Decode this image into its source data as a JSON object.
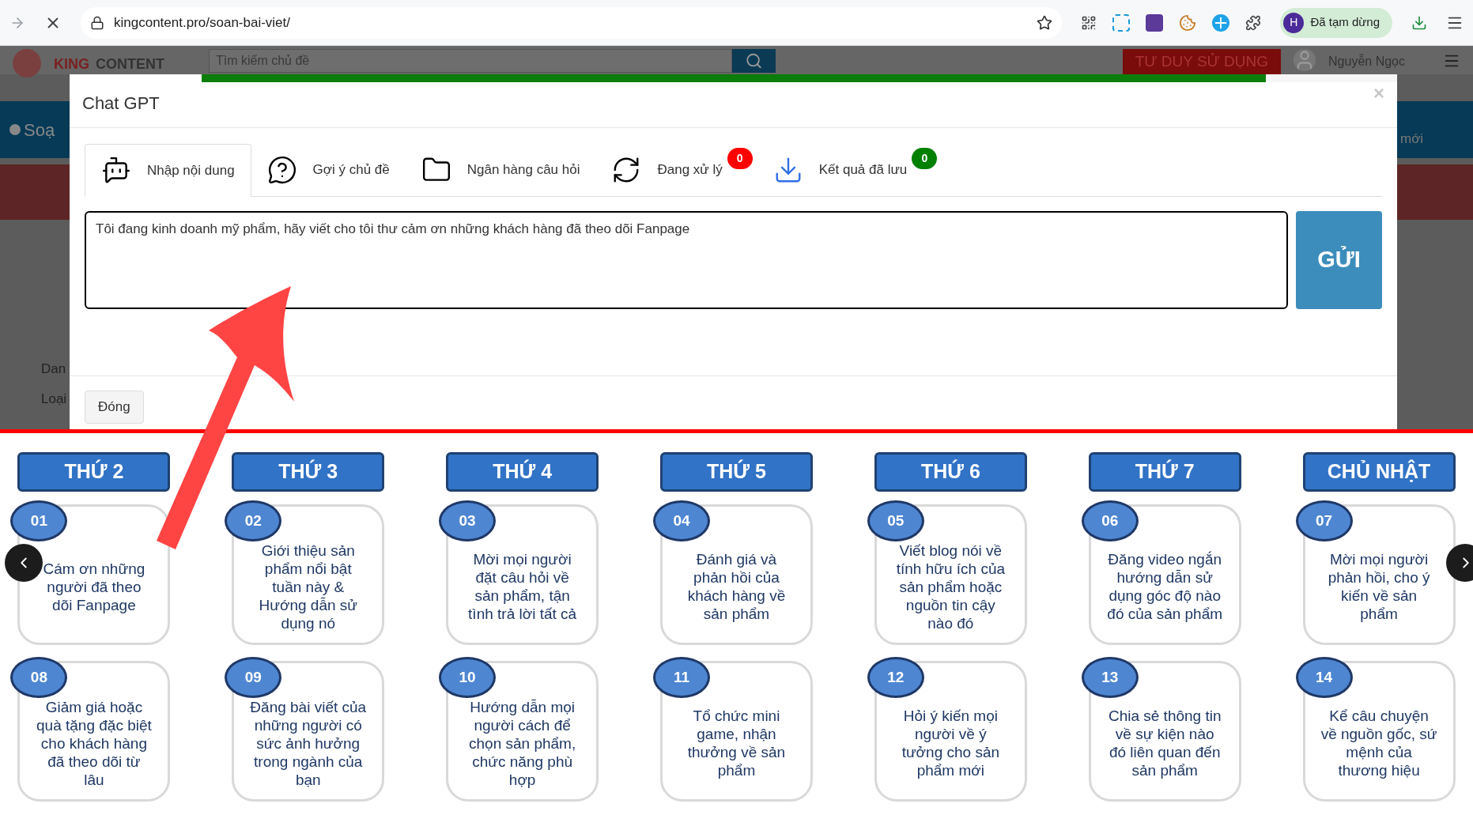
{
  "browser": {
    "url": "kingcontent.pro/soan-bai-viet/",
    "profile": {
      "initial": "H",
      "status": "Đã tạm dừng"
    }
  },
  "background_page": {
    "logo": [
      "KING",
      "CONTENT"
    ],
    "search_placeholder": "Tìm kiếm chủ đề",
    "header_button": "TƯ DUY SỬ DỤNG",
    "user_name": "Nguyễn Ngọc",
    "nav_left": "Soạ",
    "nav_right": "mới",
    "labels": [
      "Dan",
      "Loại"
    ]
  },
  "modal": {
    "title": "Chat GPT",
    "close": "×",
    "progress": {
      "level": 0.89
    },
    "tabs": [
      {
        "label": "Nhập nội dung",
        "selected": true
      },
      {
        "label": "Gợi ý chủ đề",
        "selected": false
      },
      {
        "label": "Ngân hàng câu hỏi",
        "selected": false
      },
      {
        "label": "Đang xử lý",
        "selected": false,
        "badge": {
          "text": "0",
          "color": "#ff0000"
        }
      },
      {
        "label": "Kết quả đã lưu",
        "selected": false,
        "badge": {
          "text": "0",
          "color": "#008000"
        }
      }
    ],
    "message": "Tôi đang kinh doanh mỹ phẩm, hãy viết cho tôi thư cảm ơn những khách hàng đã theo dõi Fanpage",
    "send_button": "GỬI",
    "close_button": "Đóng"
  },
  "calendar": {
    "days": [
      {
        "name": "THỨ 2",
        "tasks": [
          {
            "number": "01",
            "text": "Cám ơn những người đã theo dõi Fanpage"
          },
          {
            "number": "08",
            "text": "Giảm giá hoặc quà tặng đặc biệt cho khách hàng đã theo dõi từ lâu"
          }
        ]
      },
      {
        "name": "THỨ 3",
        "tasks": [
          {
            "number": "02",
            "text": "Giới thiệu sản phẩm nổi bật tuần này & Hướng dẫn sử dụng nó"
          },
          {
            "number": "09",
            "text": "Đăng bài viết của những người có sức ảnh hưởng trong ngành của bạn"
          }
        ]
      },
      {
        "name": "THỨ 4",
        "tasks": [
          {
            "number": "03",
            "text": "Mời mọi người đặt câu hỏi về sản phẩm, tận tình trả lời tất cả"
          },
          {
            "number": "10",
            "text": "Hướng dẫn mọi người cách để chọn sản phẩm, chức năng phù hợp"
          }
        ]
      },
      {
        "name": "THỨ 5",
        "tasks": [
          {
            "number": "04",
            "text": "Đánh giá và phản hồi của khách hàng về sản phẩm"
          },
          {
            "number": "11",
            "text": "Tổ chức mini game, nhận thưởng về sản phẩm"
          }
        ]
      },
      {
        "name": "THỨ 6",
        "tasks": [
          {
            "number": "05",
            "text": "Viết blog nói về tính hữu ích của sản phẩm hoặc nguồn tin cậy nào đó"
          },
          {
            "number": "12",
            "text": "Hỏi ý kiến mọi người về ý tưởng cho sản phẩm mới"
          }
        ]
      },
      {
        "name": "THỨ 7",
        "tasks": [
          {
            "number": "06",
            "text": "Đăng video ngắn hướng dẫn sử dụng góc độ nào đó của sản phẩm"
          },
          {
            "number": "13",
            "text": "Chia sẻ thông tin về sự kiện nào đó liên quan đến sản phẩm"
          }
        ]
      },
      {
        "name": "CHỦ NHẬT",
        "tasks": [
          {
            "number": "07",
            "text": "Mời mọi người phản hồi, cho ý kiến về sản phẩm"
          },
          {
            "number": "14",
            "text": "Kể câu chuyện về nguồn gốc, sứ mệnh của thương hiệu"
          }
        ]
      }
    ]
  }
}
